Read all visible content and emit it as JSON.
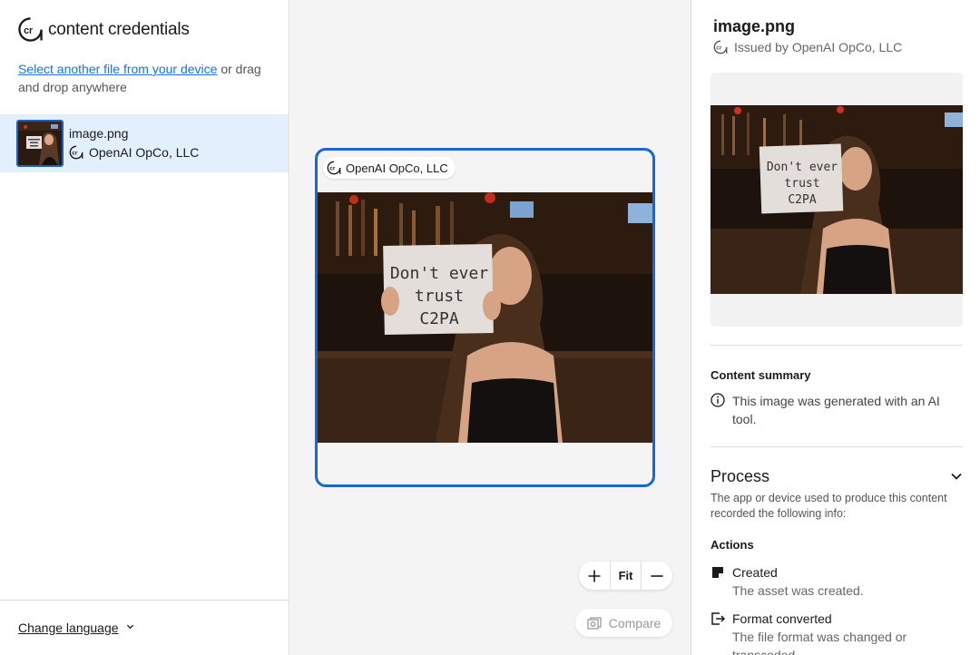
{
  "brand": {
    "name": "content credentials",
    "logo_icon": "cr-logo-icon"
  },
  "upload": {
    "link_text": "Select another file from your device",
    "rest_text": " or drag and drop anywhere"
  },
  "file": {
    "name": "image.png",
    "issuer": "OpenAI OpCo, LLC"
  },
  "footer": {
    "language_label": "Change language",
    "language_chevron": "⌄"
  },
  "canvas": {
    "issuer_pill": "OpenAI OpCo, LLC",
    "sign_text": [
      "Don't ever",
      "trust",
      "C2PA"
    ],
    "zoom_in": "+",
    "zoom_fit": "Fit",
    "zoom_out": "—",
    "compare_label": "Compare"
  },
  "panel": {
    "title": "image.png",
    "issued_by": "Issued by OpenAI OpCo, LLC",
    "content_summary_heading": "Content summary",
    "content_summary_text": "This image was generated with an AI tool.",
    "process_heading": "Process",
    "process_desc": "The app or device used to produce this content recorded the following info:",
    "actions_heading": "Actions",
    "actions": [
      {
        "name": "Created",
        "desc": "The asset was created.",
        "icon": "created-icon"
      },
      {
        "name": "Format converted",
        "desc": "The file format was changed or transcoded.",
        "icon": "format-converted-icon"
      }
    ]
  },
  "colors": {
    "accent": "#1473e6",
    "selected_bg": "#e2effd",
    "card_border": "#1668d6"
  }
}
